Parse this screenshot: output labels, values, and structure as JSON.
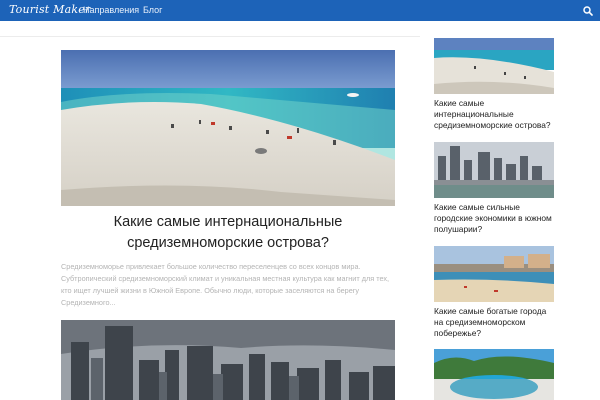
{
  "header": {
    "logo": "Tourist Maker",
    "nav": [
      "Направления",
      "Блог"
    ]
  },
  "main": {
    "title_line1": "Какие самые интернациональные",
    "title_line2": "средиземноморские острова?",
    "excerpt": "Средиземноморье привлекает большое количество переселенцев со всех концов мира. Субтропический средиземноморский климат и уникальная местная культура как магнит для тех, кто ищет лучшей жизни в Южной Европе. Обычно люди, которые заселяются на берегу Средиземного..."
  },
  "sidebar": {
    "items": [
      {
        "title": "Какие самые интернациональные средиземноморские острова?"
      },
      {
        "title": "Какие самые сильные городские экономики в южном полушарии?"
      },
      {
        "title": "Какие самые богатые города на средиземноморском побережье?"
      },
      {
        "title": ""
      }
    ]
  },
  "colors": {
    "navbar": "#1d63b8",
    "excerpt": "#b4b4b4"
  }
}
